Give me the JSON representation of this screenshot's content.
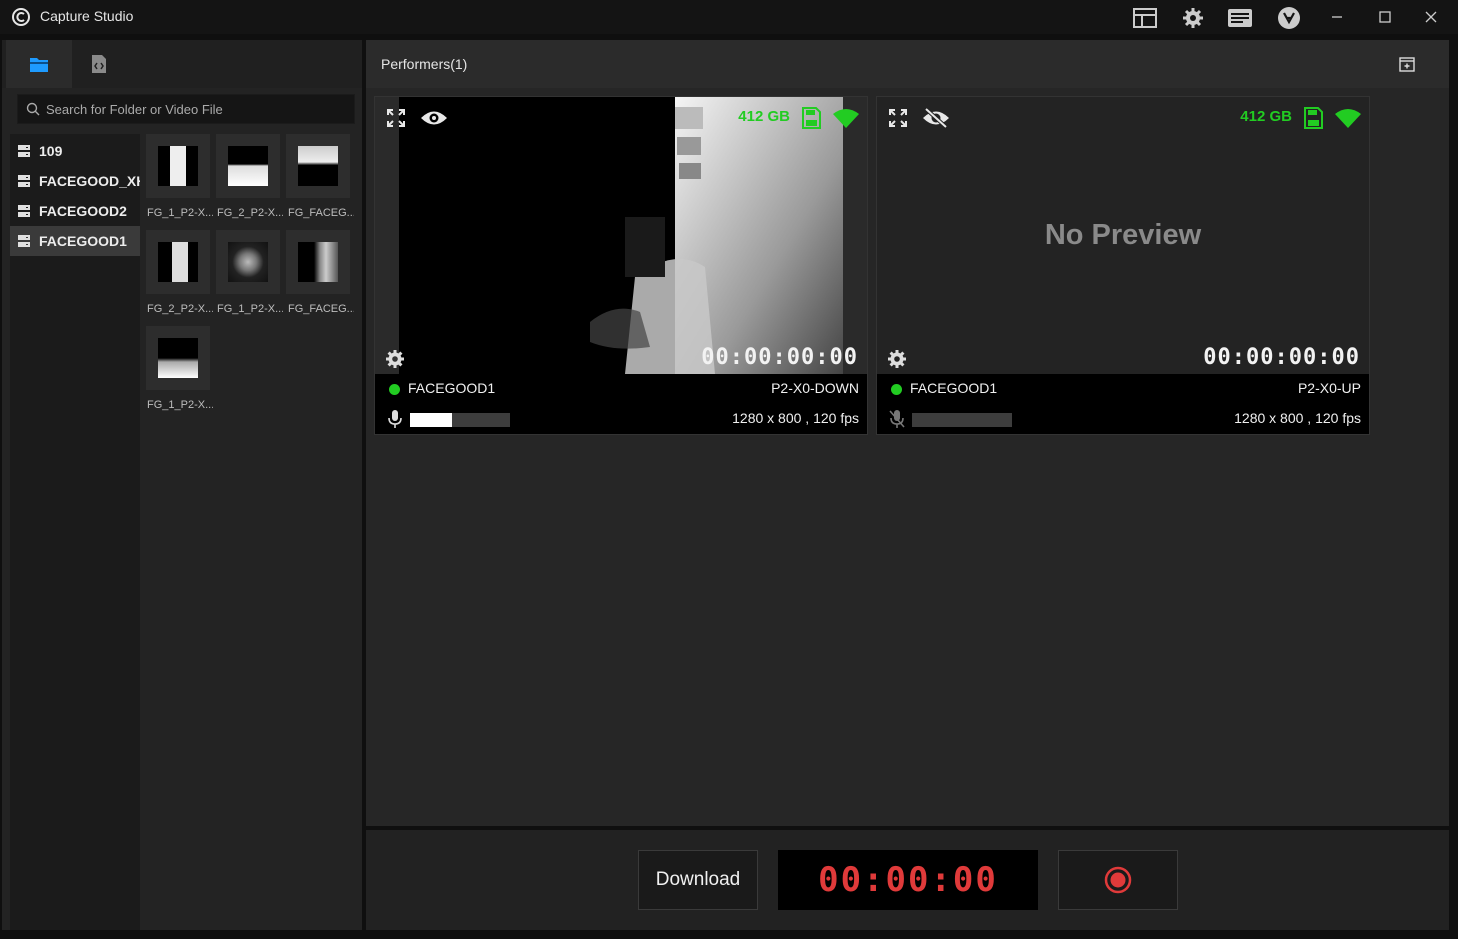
{
  "app": {
    "title": "Capture Studio"
  },
  "toolbar": {
    "icons": [
      "layout-icon",
      "gear-icon",
      "keyboard-icon",
      "logo-badge-icon"
    ],
    "window_controls": [
      "minimize-icon",
      "maximize-icon",
      "close-icon"
    ]
  },
  "left_panel": {
    "tabs": [
      {
        "icon": "folder-icon",
        "active": true
      },
      {
        "icon": "code-file-icon",
        "active": false
      }
    ],
    "search": {
      "placeholder": "Search for Folder or Video File",
      "value": ""
    },
    "folders": [
      {
        "label": "109",
        "selected": false
      },
      {
        "label": "FACEGOOD_XHW",
        "selected": false
      },
      {
        "label": "FACEGOOD2",
        "selected": false
      },
      {
        "label": "FACEGOOD1",
        "selected": true
      }
    ],
    "videos": [
      {
        "label": "FG_1_P2-X..."
      },
      {
        "label": "FG_2_P2-X..."
      },
      {
        "label": "FG_FACEG..."
      },
      {
        "label": "FG_2_P2-X..."
      },
      {
        "label": "FG_1_P2-X..."
      },
      {
        "label": "FG_FACEG..."
      },
      {
        "label": "FG_1_P2-X..."
      }
    ]
  },
  "performers": {
    "title": "Performers(1)",
    "cards": [
      {
        "storage": "412 GB",
        "preview": true,
        "timecode": "00:00:00:00",
        "performer": "FACEGOOD1",
        "camera": "P2-X0-DOWN",
        "resolution": "1280 x 800 , 120 fps",
        "audio_level": 0.42,
        "mic_muted": false,
        "visible": true
      },
      {
        "storage": "412 GB",
        "preview": false,
        "no_preview_text": "No Preview",
        "timecode": "00:00:00:00",
        "performer": "FACEGOOD1",
        "camera": "P2-X0-UP",
        "resolution": "1280 x 800 , 120 fps",
        "audio_level": 0,
        "mic_muted": true,
        "visible": false
      }
    ]
  },
  "bottom": {
    "download_label": "Download",
    "record_timer": "00:00:00",
    "record_icon": "record-icon"
  },
  "colors": {
    "accent_blue": "#1e9bff",
    "status_green": "#22cc22",
    "record_red": "#e03a3a"
  }
}
